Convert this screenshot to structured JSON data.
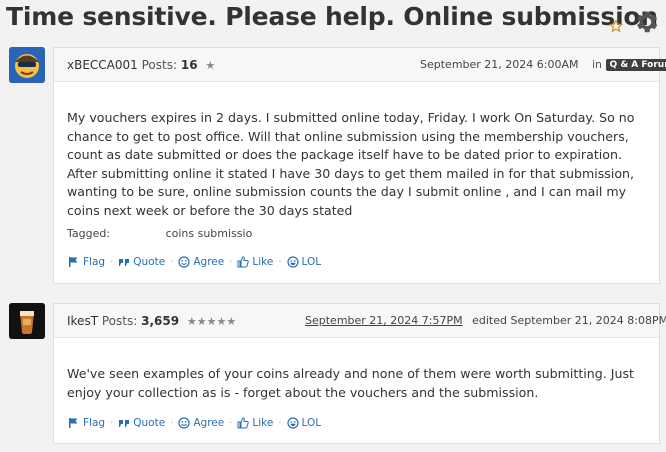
{
  "page": {
    "title": "Time sensitive. Please help. Online submission"
  },
  "colors": {
    "link": "#2a6db5",
    "star_outline": "#c9902a",
    "badge_bg": "#404040"
  },
  "icons": {
    "bookmark": "star-outline-icon",
    "settings": "gear-icon",
    "flag": "flag-icon",
    "quote": "quote-icon",
    "agree": "smile-icon",
    "like": "thumbs-up-icon",
    "lol": "laugh-icon"
  },
  "posts": [
    {
      "author": "xBECCA001",
      "posts_label": "Posts:",
      "posts_count": "16",
      "rank_stars": "★",
      "date": "September 21, 2024 6:00AM",
      "in_label": "in",
      "forum": "Q & A Forum",
      "body": "My vouchers expires in 2 days. I submitted online today, Friday. I work On Saturday. So no chance to get to post office. Will that online submission using the membership vouchers, count as date submitted or does the package itself have to be dated prior to expiration. After submitting online it stated I have 30 days to get them mailed in for that submission, wanting to be sure, online submission counts the day I submit online , and I can mail my coins next week or before the 30 days stated",
      "tagged_label": "Tagged:",
      "tag": "coins submissio",
      "reactions": [
        "Flag",
        "Quote",
        "Agree",
        "Like",
        "LOL"
      ]
    },
    {
      "author": "IkesT",
      "posts_label": "Posts:",
      "posts_count": "3,659",
      "rank_stars": "★★★★★",
      "date": "September 21, 2024 7:57PM",
      "edited": "edited September 21, 2024 8:08PM",
      "body": "We've seen examples of your coins already and none of them were worth submitting. Just enjoy your collection as is - forget about the vouchers and the submission.",
      "reactions": [
        "Flag",
        "Quote",
        "Agree",
        "Like",
        "LOL"
      ]
    }
  ]
}
